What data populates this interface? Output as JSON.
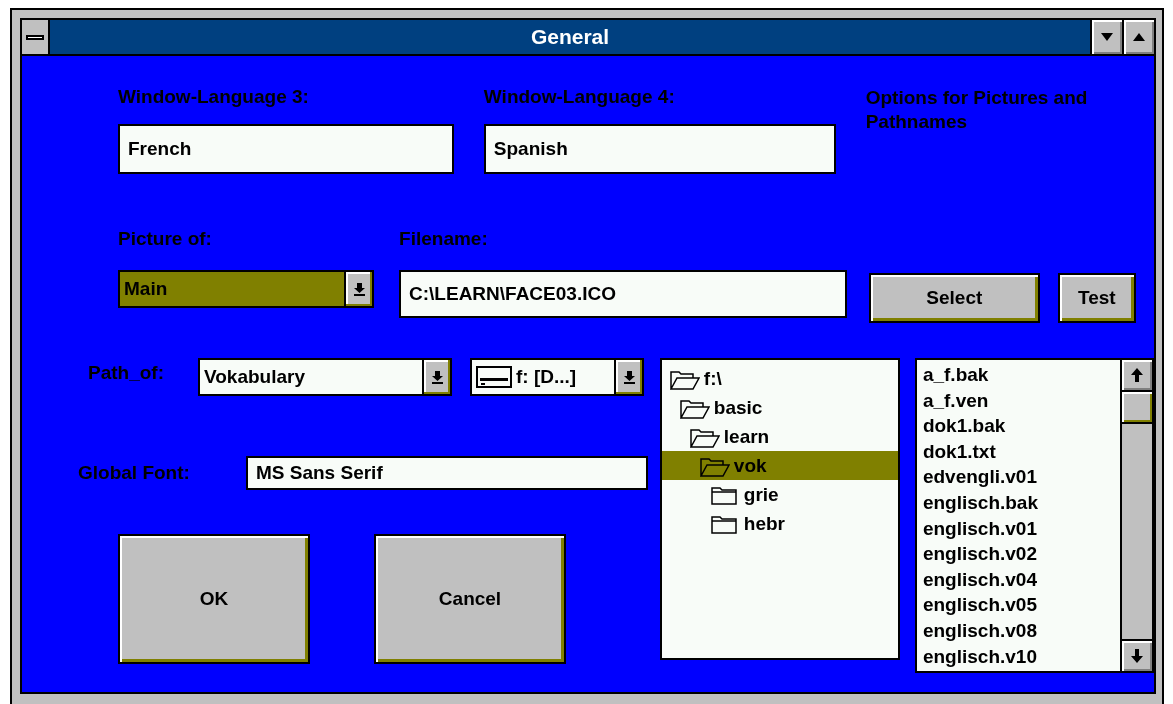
{
  "window": {
    "title": "General"
  },
  "languages": [
    {
      "label": "Window-Language 3:",
      "value": "French"
    },
    {
      "label": "Window-Language 4:",
      "value": "Spanish"
    }
  ],
  "options_heading": "Options for Pictures and Pathnames",
  "picture_of": {
    "label": "Picture of:",
    "value": "Main"
  },
  "filename": {
    "label": "Filename:",
    "value": "C:\\LEARN\\FACE03.ICO"
  },
  "file_buttons": [
    "Select",
    "Test"
  ],
  "path_of": {
    "label": "Path_of:",
    "value": "Vokabulary"
  },
  "drive": {
    "value": "f: [D...]"
  },
  "global_font": {
    "label": "Global Font:",
    "value": "MS Sans Serif"
  },
  "folders": [
    {
      "name": "f:\\",
      "expanded": true,
      "selected": false,
      "children": [
        {
          "name": "basic",
          "expanded": true,
          "selected": false,
          "children": [
            {
              "name": "learn",
              "expanded": true,
              "selected": false,
              "children": [
                {
                  "name": "vok",
                  "expanded": true,
                  "selected": true,
                  "children": [
                    {
                      "name": "grie",
                      "expanded": false,
                      "selected": false
                    },
                    {
                      "name": "hebr",
                      "expanded": false,
                      "selected": false
                    }
                  ]
                }
              ]
            }
          ]
        }
      ]
    }
  ],
  "files": [
    "a_f.bak",
    "a_f.ven",
    "dok1.bak",
    "dok1.txt",
    "edvengli.v01",
    "englisch.bak",
    "englisch.v01",
    "englisch.v02",
    "englisch.v04",
    "englisch.v05",
    "englisch.v08",
    "englisch.v10"
  ],
  "buttons": [
    "OK",
    "Cancel"
  ]
}
